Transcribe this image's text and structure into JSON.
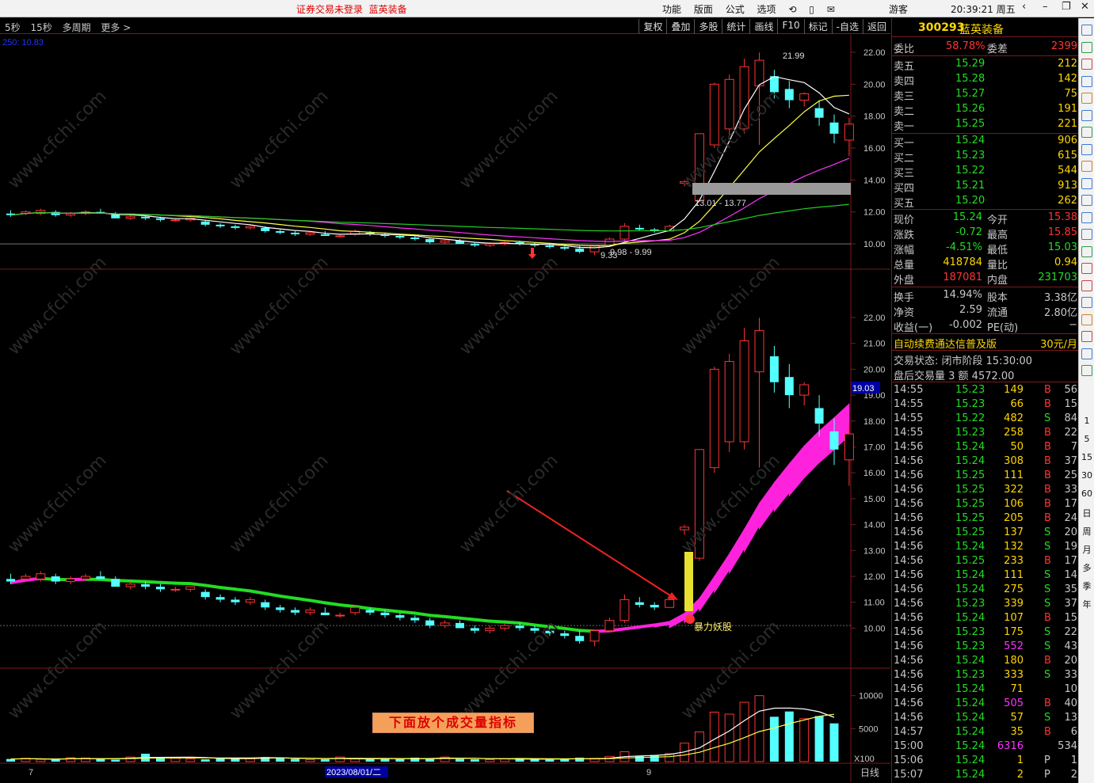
{
  "topbar": {
    "warning": "证券交易未登录",
    "stock_name": "蓝英装备",
    "menu": [
      "功能",
      "版面",
      "公式",
      "选项"
    ],
    "guest": "游客",
    "clock": "20:39:21 周五"
  },
  "toolbar": {
    "left": [
      "5秒",
      "15秒",
      "多周期",
      "更多 >"
    ],
    "right": [
      "复权",
      "叠加",
      "多股",
      "统计",
      "画线",
      "F10",
      "标记",
      "-自选",
      "返回"
    ]
  },
  "main_chart": {
    "ma_label": "250: 10.83",
    "price_ticks": [
      "22.00",
      "20.00",
      "18.00",
      "16.00",
      "14.00",
      "12.00",
      "10.00"
    ],
    "high_label": "21.99",
    "low_label": "9.33",
    "range_label_low": "9.98 - 9.99",
    "range_label_high": "13.01 - 13.77"
  },
  "mid_chart": {
    "price_ticks": [
      "22.00",
      "21.00",
      "20.00",
      "19.00",
      "18.00",
      "17.00",
      "16.00",
      "15.00",
      "14.00",
      "13.00",
      "12.00",
      "11.00",
      "10.00"
    ],
    "current_price_tag": "19.03",
    "signal_label": "暴力妖股"
  },
  "vol_chart": {
    "ticks": [
      "10000",
      "5000"
    ],
    "unit": "X100",
    "note": "下面放个成交量指标"
  },
  "axis": {
    "x_labels": [
      "7",
      "2023/08/01/二",
      "9"
    ],
    "period": "日线"
  },
  "chart_data": [
    {
      "type": "line",
      "title": "",
      "candles": [
        {
          "o": 11.9,
          "h": 12.1,
          "l": 11.7,
          "c": 11.8
        },
        {
          "o": 11.9,
          "h": 12.1,
          "l": 11.8,
          "c": 12.0
        },
        {
          "o": 11.9,
          "h": 12.2,
          "l": 11.8,
          "c": 12.1
        },
        {
          "o": 12.0,
          "h": 12.1,
          "l": 11.7,
          "c": 11.8
        },
        {
          "o": 11.8,
          "h": 12.0,
          "l": 11.7,
          "c": 11.9
        },
        {
          "o": 11.9,
          "h": 12.1,
          "l": 11.8,
          "c": 12.0
        },
        {
          "o": 12.0,
          "h": 12.2,
          "l": 11.9,
          "c": 11.9
        },
        {
          "o": 11.9,
          "h": 12.0,
          "l": 11.6,
          "c": 11.6
        },
        {
          "o": 11.6,
          "h": 11.8,
          "l": 11.5,
          "c": 11.7
        },
        {
          "o": 11.7,
          "h": 11.8,
          "l": 11.5,
          "c": 11.6
        },
        {
          "o": 11.6,
          "h": 11.7,
          "l": 11.4,
          "c": 11.5
        },
        {
          "o": 11.5,
          "h": 11.6,
          "l": 11.4,
          "c": 11.5
        },
        {
          "o": 11.5,
          "h": 11.6,
          "l": 11.4,
          "c": 11.6
        },
        {
          "o": 11.4,
          "h": 11.5,
          "l": 11.1,
          "c": 11.2
        },
        {
          "o": 11.2,
          "h": 11.3,
          "l": 11.0,
          "c": 11.1
        },
        {
          "o": 11.1,
          "h": 11.2,
          "l": 10.9,
          "c": 11.0
        },
        {
          "o": 11.0,
          "h": 11.2,
          "l": 10.9,
          "c": 11.1
        },
        {
          "o": 11.0,
          "h": 11.1,
          "l": 10.7,
          "c": 10.8
        },
        {
          "o": 10.8,
          "h": 10.9,
          "l": 10.6,
          "c": 10.7
        },
        {
          "o": 10.7,
          "h": 10.8,
          "l": 10.5,
          "c": 10.6
        },
        {
          "o": 10.6,
          "h": 10.8,
          "l": 10.5,
          "c": 10.7
        },
        {
          "o": 10.6,
          "h": 10.8,
          "l": 10.5,
          "c": 10.5
        },
        {
          "o": 10.5,
          "h": 10.6,
          "l": 10.4,
          "c": 10.5
        },
        {
          "o": 10.6,
          "h": 10.9,
          "l": 10.5,
          "c": 10.8
        },
        {
          "o": 10.7,
          "h": 10.8,
          "l": 10.5,
          "c": 10.6
        },
        {
          "o": 10.6,
          "h": 10.7,
          "l": 10.4,
          "c": 10.5
        },
        {
          "o": 10.5,
          "h": 10.6,
          "l": 10.3,
          "c": 10.4
        },
        {
          "o": 10.4,
          "h": 10.5,
          "l": 10.2,
          "c": 10.3
        },
        {
          "o": 10.3,
          "h": 10.4,
          "l": 10.0,
          "c": 10.1
        },
        {
          "o": 10.1,
          "h": 10.3,
          "l": 10.0,
          "c": 10.2
        },
        {
          "o": 10.2,
          "h": 10.3,
          "l": 10.0,
          "c": 10.0
        },
        {
          "o": 10.0,
          "h": 10.1,
          "l": 9.8,
          "c": 9.9
        },
        {
          "o": 9.9,
          "h": 10.1,
          "l": 9.8,
          "c": 10.0
        },
        {
          "o": 10.0,
          "h": 10.2,
          "l": 9.9,
          "c": 10.1
        },
        {
          "o": 10.1,
          "h": 10.2,
          "l": 9.9,
          "c": 10.0
        },
        {
          "o": 10.0,
          "h": 10.1,
          "l": 9.8,
          "c": 9.9
        },
        {
          "o": 9.9,
          "h": 10.0,
          "l": 9.7,
          "c": 9.8
        },
        {
          "o": 9.8,
          "h": 9.9,
          "l": 9.6,
          "c": 9.7
        },
        {
          "o": 9.7,
          "h": 9.9,
          "l": 9.4,
          "c": 9.5
        },
        {
          "o": 9.5,
          "h": 9.9,
          "l": 9.3,
          "c": 9.9
        },
        {
          "o": 9.9,
          "h": 10.4,
          "l": 9.9,
          "c": 10.3
        },
        {
          "o": 10.3,
          "h": 11.3,
          "l": 10.2,
          "c": 11.1
        },
        {
          "o": 11.0,
          "h": 11.2,
          "l": 10.8,
          "c": 10.9
        },
        {
          "o": 10.9,
          "h": 11.0,
          "l": 10.7,
          "c": 10.8
        },
        {
          "o": 10.8,
          "h": 11.2,
          "l": 10.8,
          "c": 11.1
        },
        {
          "o": 13.8,
          "h": 14.0,
          "l": 13.6,
          "c": 13.9
        },
        {
          "o": 12.7,
          "h": 16.9,
          "l": 12.6,
          "c": 16.9
        },
        {
          "o": 16.2,
          "h": 20.1,
          "l": 16.0,
          "c": 20.0
        },
        {
          "o": 17.2,
          "h": 20.6,
          "l": 16.8,
          "c": 20.3
        },
        {
          "o": 17.2,
          "h": 21.6,
          "l": 16.9,
          "c": 21.1
        },
        {
          "o": 19.9,
          "h": 21.99,
          "l": 16.2,
          "c": 21.5
        },
        {
          "o": 20.5,
          "h": 20.9,
          "l": 19.1,
          "c": 19.5
        },
        {
          "o": 19.7,
          "h": 20.2,
          "l": 18.5,
          "c": 19.0
        },
        {
          "o": 19.0,
          "h": 19.5,
          "l": 18.6,
          "c": 19.4
        },
        {
          "o": 18.5,
          "h": 19.0,
          "l": 17.4,
          "c": 17.9
        },
        {
          "o": 17.6,
          "h": 18.1,
          "l": 16.3,
          "c": 16.9
        },
        {
          "o": 16.5,
          "h": 17.9,
          "l": 15.5,
          "c": 17.5
        }
      ],
      "volume": [
        400,
        500,
        350,
        300,
        600,
        550,
        450,
        300,
        700,
        1200,
        600,
        500,
        400,
        350,
        600,
        500,
        450,
        700,
        600,
        400,
        300,
        350,
        700,
        400,
        350,
        500,
        400,
        600,
        500,
        700,
        400,
        350,
        300,
        400,
        550,
        350,
        300,
        400,
        600,
        500,
        800,
        1500,
        900,
        1000,
        1200,
        2800,
        4500,
        7500,
        7200,
        9000,
        10000,
        6800,
        7600,
        6500,
        6900,
        5800
      ],
      "xlabel": "",
      "ylabel": ""
    }
  ],
  "quote": {
    "code": "300293",
    "name": "蓝英装备",
    "weibi_label": "委比",
    "weibi": "58.78%",
    "weicha_label": "委差",
    "weicha": "2399",
    "asks": [
      {
        "label": "卖五",
        "price": "15.29",
        "vol": "212"
      },
      {
        "label": "卖四",
        "price": "15.28",
        "vol": "142"
      },
      {
        "label": "卖三",
        "price": "15.27",
        "vol": "75"
      },
      {
        "label": "卖二",
        "price": "15.26",
        "vol": "191"
      },
      {
        "label": "卖一",
        "price": "15.25",
        "vol": "221"
      }
    ],
    "bids": [
      {
        "label": "买一",
        "price": "15.24",
        "vol": "906"
      },
      {
        "label": "买二",
        "price": "15.23",
        "vol": "615"
      },
      {
        "label": "买三",
        "price": "15.22",
        "vol": "544"
      },
      {
        "label": "买四",
        "price": "15.21",
        "vol": "913"
      },
      {
        "label": "买五",
        "price": "15.20",
        "vol": "262"
      }
    ],
    "stats": [
      [
        "现价",
        "15.24",
        "今开",
        "15.38"
      ],
      [
        "涨跌",
        "-0.72",
        "最高",
        "15.85"
      ],
      [
        "涨幅",
        "-4.51%",
        "最低",
        "15.03"
      ],
      [
        "总量",
        "418784",
        "量比",
        "0.94"
      ],
      [
        "外盘",
        "187081",
        "内盘",
        "231703"
      ]
    ],
    "fund": [
      [
        "换手",
        "14.94%",
        "股本",
        "3.38亿"
      ],
      [
        "净资",
        "2.59",
        "流通",
        "2.80亿"
      ],
      [
        "收益(一)",
        "-0.002",
        "PE(动)",
        "−"
      ]
    ],
    "promo": "自动续费通达信普及版",
    "promo_price": "30元/月",
    "status": "交易状态: 闭市阶段 15:30:00",
    "after_hours": "盘后交易量 3 额 4572.00"
  },
  "trades": [
    [
      "14:55",
      "15.23",
      "149",
      "B",
      "56"
    ],
    [
      "14:55",
      "15.23",
      "66",
      "B",
      "15"
    ],
    [
      "14:55",
      "15.22",
      "482",
      "S",
      "84"
    ],
    [
      "14:55",
      "15.23",
      "258",
      "B",
      "22"
    ],
    [
      "14:56",
      "15.24",
      "50",
      "B",
      "7"
    ],
    [
      "14:56",
      "15.24",
      "308",
      "B",
      "37"
    ],
    [
      "14:56",
      "15.25",
      "111",
      "B",
      "25"
    ],
    [
      "14:56",
      "15.25",
      "322",
      "B",
      "33"
    ],
    [
      "14:56",
      "15.25",
      "106",
      "B",
      "17"
    ],
    [
      "14:56",
      "15.25",
      "205",
      "B",
      "24"
    ],
    [
      "14:56",
      "15.25",
      "137",
      "S",
      "20"
    ],
    [
      "14:56",
      "15.24",
      "132",
      "S",
      "19"
    ],
    [
      "14:56",
      "15.25",
      "233",
      "B",
      "17"
    ],
    [
      "14:56",
      "15.24",
      "111",
      "S",
      "14"
    ],
    [
      "14:56",
      "15.24",
      "275",
      "S",
      "35"
    ],
    [
      "14:56",
      "15.23",
      "339",
      "S",
      "37"
    ],
    [
      "14:56",
      "15.24",
      "107",
      "B",
      "15"
    ],
    [
      "14:56",
      "15.23",
      "175",
      "S",
      "22"
    ],
    [
      "14:56",
      "15.23",
      "552",
      "S",
      "43"
    ],
    [
      "14:56",
      "15.24",
      "180",
      "B",
      "20"
    ],
    [
      "14:56",
      "15.23",
      "333",
      "S",
      "33"
    ],
    [
      "14:56",
      "15.24",
      "71",
      "",
      "10"
    ],
    [
      "14:56",
      "15.24",
      "505",
      "B",
      "40"
    ],
    [
      "14:56",
      "15.24",
      "57",
      "S",
      "13"
    ],
    [
      "14:57",
      "15.24",
      "35",
      "B",
      "6"
    ],
    [
      "15:00",
      "15.24",
      "6316",
      "",
      "534"
    ],
    [
      "15:06",
      "15.24",
      "1",
      "P",
      "1"
    ],
    [
      "15:07",
      "15.24",
      "2",
      "P",
      "2"
    ]
  ],
  "right_strip": [
    "1",
    "5",
    "15",
    "30",
    "60",
    "日",
    "周",
    "月",
    "多",
    "季",
    "年"
  ],
  "colors": {
    "up": "#ff3333",
    "down": "#54ffff",
    "grid": "#7a1a1a",
    "ma_green": "#22dd22",
    "ma_pink": "#ff22dd",
    "yellow": "#ffff44"
  }
}
